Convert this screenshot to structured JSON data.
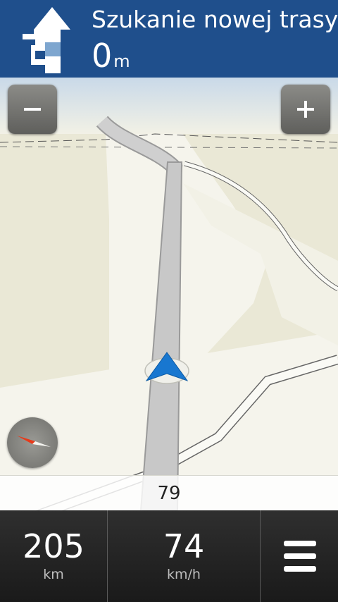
{
  "header": {
    "instruction": "Szukanie nowej trasy",
    "distance_value": "0",
    "distance_unit": "m",
    "maneuver_icon": "reroute-arrow-icon",
    "color": "#1f4f8c"
  },
  "zoom": {
    "out_icon": "minus-icon",
    "in_icon": "plus-icon"
  },
  "map": {
    "street_name": "79",
    "position_icon": "navigation-arrow-icon",
    "compass_icon": "compass-icon"
  },
  "bottom": {
    "distance_value": "205",
    "distance_unit": "km",
    "speed_value": "74",
    "speed_unit": "km/h",
    "menu_icon": "menu-icon"
  }
}
